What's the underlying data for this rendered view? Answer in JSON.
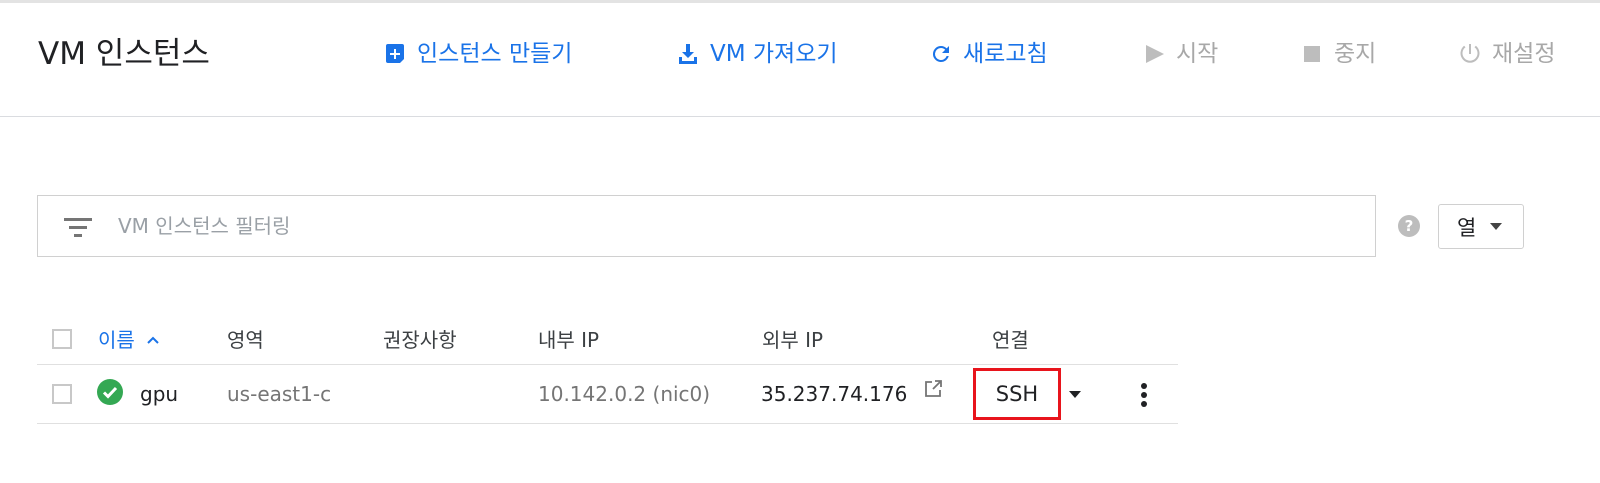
{
  "header": {
    "title": "VM 인스턴스",
    "toolbar": {
      "create": "인스턴스 만들기",
      "import": "VM 가져오기",
      "refresh": "새로고침",
      "start": "시작",
      "stop": "중지",
      "reset": "재설정"
    }
  },
  "filter": {
    "placeholder": "VM 인스턴스 필터링"
  },
  "columns_button": {
    "label": "열"
  },
  "table": {
    "headers": {
      "name": "이름",
      "zone": "영역",
      "recommendation": "권장사항",
      "internal_ip": "내부 IP",
      "external_ip": "외부 IP",
      "connect": "연결"
    },
    "rows": [
      {
        "name": "gpu",
        "status": "running",
        "zone": "us-east1-c",
        "recommendation": "",
        "internal_ip": "10.142.0.2",
        "nic": "(nic0)",
        "external_ip": "35.237.74.176",
        "connect": "SSH"
      }
    ]
  },
  "colors": {
    "accent": "#1a73e8",
    "disabled": "#a8a8a8",
    "status_ok": "#34a853",
    "highlight": "#e8141c"
  },
  "icons": {
    "create": "add-box-icon",
    "import": "download-icon",
    "refresh": "refresh-icon",
    "start": "play-icon",
    "stop": "stop-icon",
    "reset": "power-icon",
    "filter": "filter-icon",
    "help": "help-icon",
    "sort": "chevron-up-icon",
    "status": "check-circle-icon",
    "external": "external-link-icon",
    "more": "more-vert-icon"
  }
}
